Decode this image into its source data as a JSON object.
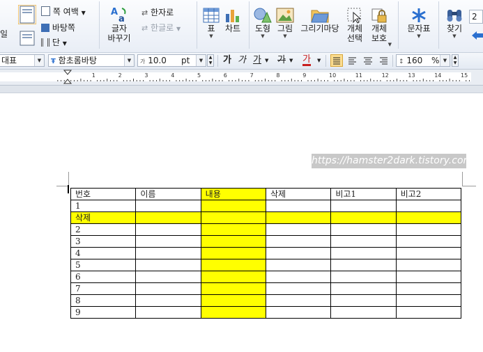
{
  "ribbon": {
    "left_cut_label": "일",
    "page_margin": "쪽 여백",
    "master_page": "바탕쪽",
    "columns": "단",
    "change_case": [
      "글자",
      "바꾸기"
    ],
    "hanja": "한자로",
    "hangul": "한글로",
    "table": "표",
    "chart": "차트",
    "shape": "도형",
    "picture": "그림",
    "drawing_gallery": "그리기마당",
    "object_select": [
      "개체",
      "선택"
    ],
    "object_protect": [
      "개체",
      "보호"
    ],
    "special_char": "문자표",
    "find": "찾기",
    "right_cut_value": "2"
  },
  "format_bar": {
    "style": "대표",
    "font": "함초롬바탕",
    "size": "10.0",
    "unit": "pt",
    "bold": "가",
    "italic": "가",
    "underline": "가",
    "strike": "가",
    "font_color": "가",
    "line_spacing": "160",
    "line_spacing_unit": "%"
  },
  "ruler": {
    "numbers": [
      "1",
      "2",
      "3",
      "4",
      "5",
      "6",
      "7",
      "8",
      "9",
      "10",
      "11",
      "12",
      "13",
      "14",
      "15"
    ]
  },
  "watermark": "https://hamster2dark.tistory.com",
  "table": {
    "rows": [
      [
        "번호",
        "이름",
        "내용",
        "삭제",
        "비고1",
        "비고2"
      ],
      [
        "1",
        "",
        "",
        "",
        "",
        ""
      ],
      [
        "삭제",
        "",
        "",
        "",
        "",
        ""
      ],
      [
        "2",
        "",
        "",
        "",
        "",
        ""
      ],
      [
        "3",
        "",
        "",
        "",
        "",
        ""
      ],
      [
        "4",
        "",
        "",
        "",
        "",
        ""
      ],
      [
        "5",
        "",
        "",
        "",
        "",
        ""
      ],
      [
        "6",
        "",
        "",
        "",
        "",
        ""
      ],
      [
        "7",
        "",
        "",
        "",
        "",
        ""
      ],
      [
        "8",
        "",
        "",
        "",
        "",
        ""
      ],
      [
        "9",
        "",
        "",
        "",
        "",
        ""
      ]
    ],
    "highlight_color": "#ffff00"
  },
  "colors": {
    "ribbon_bg": "#e9eef6",
    "accent_blue": "#2a6fcf"
  }
}
